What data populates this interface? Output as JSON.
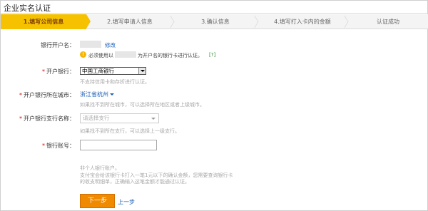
{
  "page": {
    "title": "企业实名认证"
  },
  "steps": [
    {
      "label": "1.填写公司信息",
      "active": true
    },
    {
      "label": "2.填写申请人信息",
      "active": false
    },
    {
      "label": "3.确认信息",
      "active": false
    },
    {
      "label": "4.填写打入卡内的金额",
      "active": false
    },
    {
      "label": "认证成功",
      "active": false
    }
  ],
  "form": {
    "account_name": {
      "label": "银行开户名：",
      "modify_link": "修改",
      "notice_prefix": "必须使用以",
      "notice_suffix": "为开户名的银行卡进行认证。",
      "help_link": "[?]"
    },
    "bank": {
      "required_mark": "*",
      "label": "开户银行：",
      "value": "中国工商银行",
      "hint": "不支持信用卡和存折进行认证。"
    },
    "city": {
      "required_mark": "*",
      "label": "开户银行所在城市：",
      "value": "浙江省杭州",
      "hint": "如果找不到所在城市，可以选择所在地区或者上级城市。"
    },
    "branch": {
      "required_mark": "*",
      "label": "开户银行支行名称：",
      "placeholder": "请选择支行",
      "hint": "如果找不到所在支行，可以选择上一级支行。"
    },
    "account": {
      "required_mark": "*",
      "label": "银行账号：",
      "value": "",
      "hint_line1": "非个人银行账户。",
      "hint_line2": "支付宝会给该银行卡打入一笔1元以下的确认金额，您需要查询银行卡",
      "hint_line3": "的收支明细单，正确输入这笔金额才能通过认证。"
    }
  },
  "actions": {
    "next_label": "下一步",
    "prev_label": "上一步"
  },
  "colors": {
    "active_step": "#f6c200",
    "required": "#e40000",
    "link": "#1a5fb4",
    "primary_button": "#f08a00"
  }
}
